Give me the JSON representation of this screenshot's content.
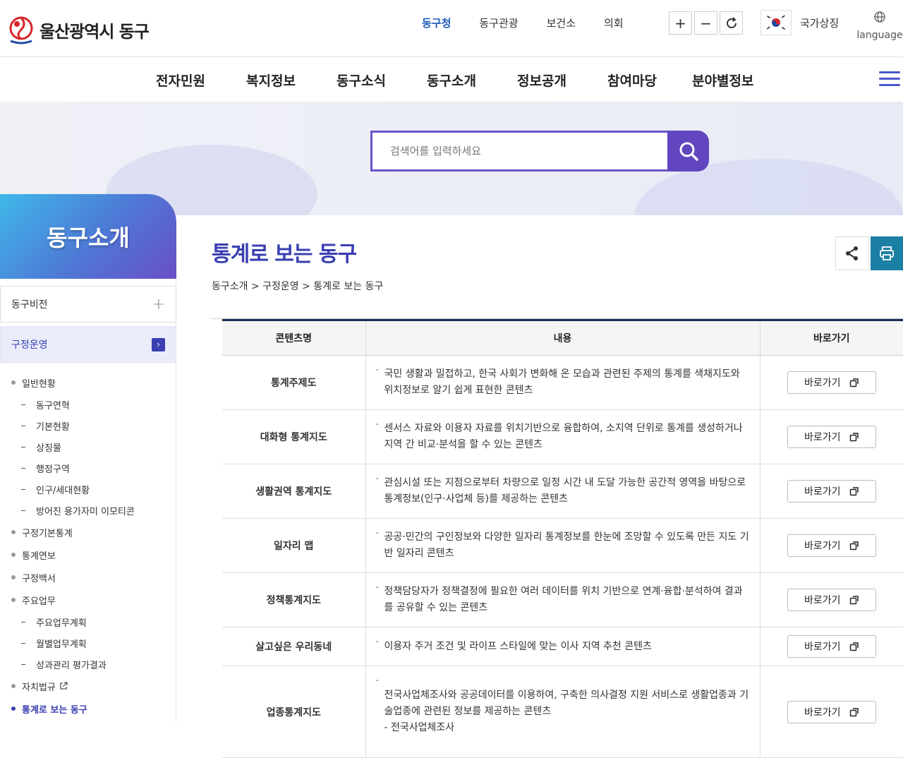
{
  "header": {
    "logo_text": "울산광역시 동구",
    "top_links": [
      "동구청",
      "동구관광",
      "보건소",
      "의회"
    ],
    "zoom_in": "+",
    "zoom_out": "−",
    "symbol_label": "국가상징",
    "language_label": "language"
  },
  "gnb": {
    "items": [
      "전자민원",
      "복지정보",
      "동구소식",
      "동구소개",
      "정보공개",
      "참여마당",
      "분야별정보"
    ]
  },
  "search": {
    "placeholder": "검색어를 입력하세요"
  },
  "lnb": {
    "title": "동구소개",
    "depth1": [
      {
        "label": "동구비전",
        "icon": "plus-icon"
      },
      {
        "label": "구정운영",
        "icon": "chevron-right-icon"
      }
    ],
    "items": [
      {
        "label": "일반현황",
        "level": 2
      },
      {
        "label": "동구연혁",
        "level": 3
      },
      {
        "label": "기본현황",
        "level": 3
      },
      {
        "label": "상징물",
        "level": 3
      },
      {
        "label": "행정구역",
        "level": 3
      },
      {
        "label": "인구/세대현황",
        "level": 3
      },
      {
        "label": "방어진 용가자미 이모티콘",
        "level": 3
      },
      {
        "label": "구정기본통계",
        "level": 2
      },
      {
        "label": "통계연보",
        "level": 2
      },
      {
        "label": "구정백서",
        "level": 2
      },
      {
        "label": "주요업무",
        "level": 2
      },
      {
        "label": "주요업무계획",
        "level": 3
      },
      {
        "label": "월별업무계획",
        "level": 3
      },
      {
        "label": "성과관리 평가결과",
        "level": 3
      },
      {
        "label": "자치법규",
        "level": 2
      },
      {
        "label": "통계로 보는 동구",
        "level": 2
      }
    ]
  },
  "content": {
    "title": "통계로 보는 동구",
    "breadcrumb": "동구소개 > 구정운영 > 통계로 보는 동구",
    "table": {
      "headers": [
        "콘텐츠명",
        "내용",
        "바로가기"
      ],
      "rows": [
        {
          "name": "통계주제도",
          "desc": "국민 생활과 밀접하고, 한국 사회가 변화해 온 모습과 관련된 주제의 통계를 색채지도와 위치정보로 알기 쉽게 표현한 콘텐츠",
          "go": "바로가기"
        },
        {
          "name": "대화형 통계지도",
          "desc": "센서스 자료와 이용자 자료를 위치기반으로 융합하여, 소지역 단위로 통계를 생성하거나 지역 간 비교·분석을 할 수 있는 콘텐츠",
          "go": "바로가기"
        },
        {
          "name": "생활권역 통계지도",
          "desc": "관심시설 또는 지점으로부터 차량으로 일정 시간 내 도달 가능한 공간적 영역을 바탕으로 통계정보(인구·사업체 등)를 제공하는 콘텐츠",
          "go": "바로가기"
        },
        {
          "name": "일자리 맵",
          "desc": "공공·민간의 구인정보와 다양한 일자리 통계정보를 한눈에 조망할 수 있도록 만든 지도 기반 일자리 콘텐츠",
          "go": "바로가기"
        },
        {
          "name": "정책통계지도",
          "desc": "정책담당자가 정책결정에 필요한 여러 데이터를 위치 기반으로 연계·융합·분석하여 결과를 공유할 수 있는 콘텐츠",
          "go": "바로가기"
        },
        {
          "name": "살고싶은 우리동네",
          "desc": "이용자 주거 조건 및 라이프 스타일에 맞는 이사 지역 추천 콘텐츠",
          "go": "바로가기"
        },
        {
          "name": "업종통계지도",
          "desc": "전국사업체조사와 공공데이터를 이용하여, 구축한 의사결정 지원 서비스로 생활업종과 기술업종에 관련된 정보를 제공하는 콘텐츠",
          "sub": "- 전국사업체조사",
          "go": "바로가기"
        }
      ]
    }
  },
  "colors": {
    "primary": "#3a3fb1",
    "search_border": "#6a55c8",
    "search_button": "#6146bf",
    "print_button": "#1c7fa4",
    "table_top_border": "#1d2a57"
  }
}
